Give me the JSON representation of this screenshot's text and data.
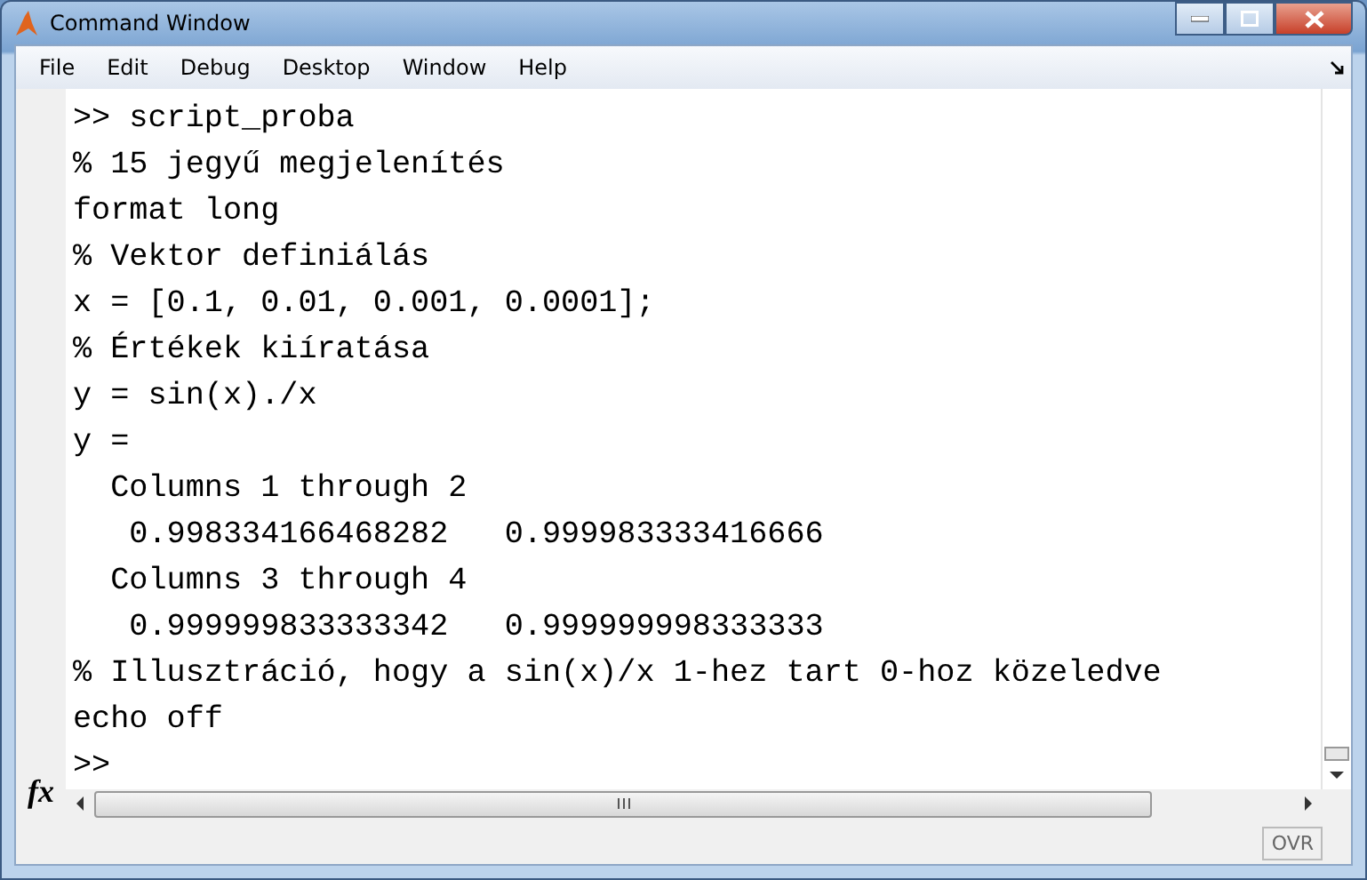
{
  "window": {
    "title": "Command Window"
  },
  "menu": [
    "File",
    "Edit",
    "Debug",
    "Desktop",
    "Window",
    "Help"
  ],
  "lines": [
    ">> script_proba",
    "% 15 jegyű megjelenítés",
    "format long",
    "% Vektor definiálás",
    "x = [0.1, 0.01, 0.001, 0.0001];",
    "% Értékek kiíratása",
    "y = sin(x)./x",
    "y =",
    "  Columns 1 through 2",
    "   0.998334166468282   0.999983333416666",
    "  Columns 3 through 4",
    "   0.999999833333342   0.999999998333333",
    "% Illusztráció, hogy a sin(x)/x 1-hez tart 0-hoz közeledve",
    "echo off"
  ],
  "prompt": ">>",
  "function_button": "fx",
  "status": "OVR"
}
